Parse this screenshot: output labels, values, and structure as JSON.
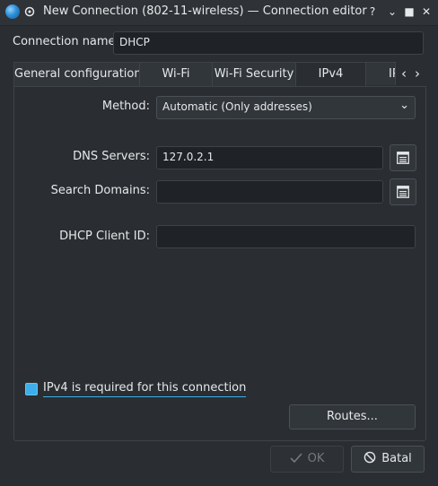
{
  "window": {
    "title": "New Connection (802-11-wireless) — Connection editor",
    "help": "?",
    "minimize": "⌄",
    "maximize": "■",
    "close": "✕"
  },
  "connection_name": {
    "label": "Connection name:",
    "value": "DHCP"
  },
  "tabs": [
    {
      "label": "General configuration"
    },
    {
      "label": "Wi-Fi"
    },
    {
      "label": "Wi-Fi Security"
    },
    {
      "label": "IPv4",
      "active": true
    },
    {
      "label": "IP"
    }
  ],
  "ipv4": {
    "method": {
      "label": "Method:",
      "value": "Automatic (Only addresses)"
    },
    "dns_servers": {
      "label": "DNS Servers:",
      "value": "127.0.2.1"
    },
    "search_domains": {
      "label": "Search Domains:",
      "value": ""
    },
    "dhcp_client_id": {
      "label": "DHCP Client ID:",
      "value": ""
    },
    "required": {
      "label": "IPv4 is required for this connection",
      "checked": true
    },
    "routes_button": "Routes..."
  },
  "buttons": {
    "ok": "OK",
    "cancel": "Batal"
  },
  "colors": {
    "accent": "#3daee9",
    "background": "#2a2e32"
  }
}
